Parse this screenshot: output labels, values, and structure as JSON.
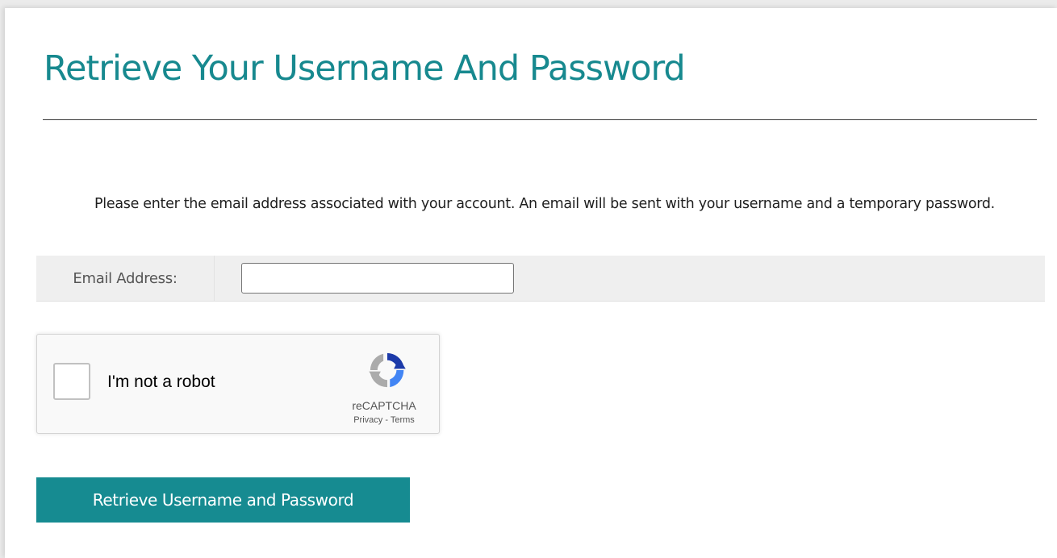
{
  "page": {
    "title": "Retrieve Your Username And Password",
    "instructions": "Please enter the email address associated with your account. An email will be sent with your username and a temporary password."
  },
  "form": {
    "email_label": "Email Address:",
    "email_value": "",
    "email_placeholder": ""
  },
  "recaptcha": {
    "checkbox_label": "I'm not a robot",
    "brand": "reCAPTCHA",
    "privacy_link": "Privacy",
    "separator": " - ",
    "terms_link": "Terms",
    "checked": false,
    "logo_icon": "recaptcha-logo-icon"
  },
  "actions": {
    "submit_label": "Retrieve Username and Password"
  },
  "colors": {
    "accent": "#168b91",
    "title": "#17898f",
    "row_background": "#efefef"
  }
}
